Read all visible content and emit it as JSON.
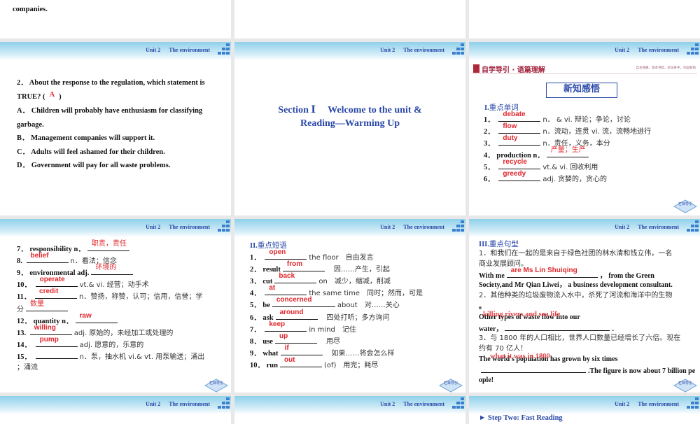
{
  "header": {
    "unit": "Unit 2",
    "topic": "The environment"
  },
  "nav_button_label": "栏目导引",
  "top_row": {
    "slide1_text": "companies."
  },
  "q_slide": {
    "question": "2． About the response to the regulation, which statement is",
    "question_cont": "TRUE? (",
    "answer": "A",
    "question_end": ")",
    "options": [
      "A． Children will probably have enthusiasm for classifying",
      "garbage.",
      "B． Management companies will support it.",
      "C． Adults will feel ashamed for their children.",
      "D． Government will pay for all waste problems."
    ]
  },
  "section_slide": {
    "line1": "Section Ⅰ　 Welcome to the unit &",
    "line2": "Reading—Warming Up"
  },
  "vocab_slide": {
    "banner": "自学导引 · 语篇理解",
    "banner_note": "自主探路，宽本寻踪，初试身手，巩固新知",
    "box_title": "新知感悟",
    "heading_num": "I.",
    "heading": "重点单词",
    "items": [
      {
        "num": "1．",
        "pre": "",
        "ans": "debate",
        "post": "n． & vi. 辩论；争论，讨论"
      },
      {
        "num": "2．",
        "pre": "",
        "ans": "flow",
        "post": "n．流动，连贯 vi. 流，流畅地进行"
      },
      {
        "num": "3．",
        "pre": "",
        "ans": "duty",
        "post": "n．责任，义务，本分"
      },
      {
        "num": "4．",
        "pre": "production n．",
        "ans": "产量；生产",
        "post": ""
      },
      {
        "num": "5．",
        "pre": "",
        "ans": "recycle",
        "post": "vt.& vi. 回收利用"
      },
      {
        "num": "6．",
        "pre": "",
        "ans": "greedy",
        "post": "adj. 贪婪的，贪心的"
      }
    ]
  },
  "vocab2_slide": {
    "items": [
      {
        "num": "7．",
        "pre": "responsibility n．",
        "ans": "职责，责任",
        "post": ""
      },
      {
        "num": "8.",
        "pre": "",
        "ans": "belief",
        "post": "n．看法；信念"
      },
      {
        "num": "9．",
        "pre": "environmental adj.",
        "ans": "环境的",
        "post": ""
      },
      {
        "num": "10．",
        "pre": "",
        "ans": "operate",
        "post": "vt.& vi. 经营；动手术"
      },
      {
        "num": "11．",
        "pre": "",
        "ans": "credit",
        "post": "n．赞扬，称赞，认可；信用，信誉；学"
      },
      {
        "num": "",
        "pre": "分",
        "ans": "数量",
        "post": ""
      },
      {
        "num": "12．",
        "pre": "quantity n．",
        "ans": "raw",
        "post": ""
      },
      {
        "num": "13.",
        "pre": "",
        "ans": "willing",
        "post": "adj. 原始的，未经加工或处理的"
      },
      {
        "num": "14．",
        "pre": "",
        "ans": "pump",
        "post": "adj. 愿意的，乐意的"
      },
      {
        "num": "15．",
        "pre": "",
        "ans": "",
        "post": "n．泵，抽水机 vi.& vt. 用泵输送；涌出"
      },
      {
        "num": "",
        "pre": "；涌流",
        "ans": null,
        "post": ""
      }
    ]
  },
  "phrase_slide": {
    "heading_num": "II.",
    "heading": "重点短语",
    "items": [
      {
        "num": "1．",
        "pre": "",
        "ans": "open",
        "post": "the floor　自由发言"
      },
      {
        "num": "2．",
        "pre": "result",
        "ans": "from",
        "post": "　因……产生，引起"
      },
      {
        "num": "3．",
        "pre": "cut",
        "ans": "back",
        "post": "on　减少，缩减，削减"
      },
      {
        "num": "4．",
        "pre": "",
        "ans": "at",
        "post": "the same time　同时；然而，可是"
      },
      {
        "num": "5．",
        "pre": "be",
        "ans": "concerned",
        "post": "about　对……关心"
      },
      {
        "num": "6．",
        "pre": "ask",
        "ans": "around",
        "post": "　四处打听；多方询问"
      },
      {
        "num": "7．",
        "pre": "",
        "ans": "keep",
        "post": "in mind　记住"
      },
      {
        "num": "8．",
        "pre": "use",
        "ans": "up",
        "post": "　用尽"
      },
      {
        "num": "9．",
        "pre": "what",
        "ans": "if",
        "post": "　如果……将会怎么样"
      },
      {
        "num": "10．",
        "pre": "run",
        "ans": "out",
        "post": "(of)　用完；耗尽"
      }
    ]
  },
  "sentence_slide": {
    "heading_num": "III.",
    "heading": "重点句型",
    "lines": [
      {
        "pre": "1．和我们在一起的是来自于绿色社团的林水清和钱立伟，一名",
        "ans": null,
        "post": ""
      },
      {
        "pre": "商业发展顾问。",
        "ans": null,
        "post": ""
      },
      {
        "pre": "With me",
        "ans": "are Ms Lin Shuiqing",
        "post": "，  from the Green"
      },
      {
        "pre": "Society,and Mr Qian Liwei， a business development consultant.",
        "ans": null,
        "post": ""
      },
      {
        "pre": "2．其他种类的垃圾废物流入水中，杀死了河流和海洋中的生物",
        "ans": null,
        "post": ""
      },
      {
        "pre": "。",
        "ans": null,
        "post": ""
      },
      {
        "pre": "Other types of waste flow into our",
        "ans": null,
        "post": ""
      },
      {
        "pre": "water，",
        "ans": "",
        "post": "."
      },
      {
        "pre": "3．与 1800 年的人口相比，世界人口数量已经增长了六倍。现在",
        "ans": null,
        "post": ""
      },
      {
        "pre": "约有 70 亿人！",
        "ans": null,
        "post": ""
      },
      {
        "pre": "The world's population has grown by six times",
        "ans": null,
        "post": ""
      },
      {
        "pre": "",
        "ans": "",
        "post": ".The figure is now about 7 billion pe"
      },
      {
        "pre": "ople!",
        "ans": null,
        "post": ""
      }
    ],
    "overlay1": "killing rivers and sea life",
    "overlay2": "what it was in 1800"
  },
  "bottom_row": {
    "slide3_text": "► Step Two: Fast Reading"
  }
}
